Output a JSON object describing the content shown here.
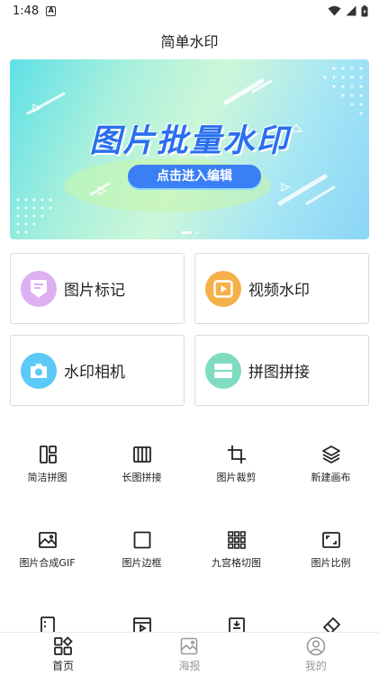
{
  "status_bar": {
    "time": "1:48",
    "notification_badge": "A"
  },
  "header": {
    "title": "简单水印"
  },
  "banner": {
    "headline": "图片批量水印",
    "cta": "点击进入编辑"
  },
  "cards": [
    {
      "label": "图片标记",
      "icon": "image-mark-icon",
      "color": "#d7a3ee"
    },
    {
      "label": "视频水印",
      "icon": "video-play-icon",
      "color": "#f5b04a"
    },
    {
      "label": "水印相机",
      "icon": "camera-icon",
      "color": "#5cc9f7"
    },
    {
      "label": "拼图拼接",
      "icon": "stitch-icon",
      "color": "#7fdcc0"
    }
  ],
  "tools": [
    {
      "label": "简洁拼图",
      "icon": "simple-collage-icon"
    },
    {
      "label": "长图拼接",
      "icon": "long-image-icon"
    },
    {
      "label": "图片裁剪",
      "icon": "crop-icon"
    },
    {
      "label": "新建画布",
      "icon": "layers-icon"
    },
    {
      "label": "图片合成GIF",
      "icon": "gif-image-icon"
    },
    {
      "label": "图片边框",
      "icon": "border-frame-icon"
    },
    {
      "label": "九宫格切图",
      "icon": "nine-grid-icon"
    },
    {
      "label": "图片比例",
      "icon": "ratio-icon"
    }
  ],
  "tools_partial": [
    {
      "icon": "film-strip-icon"
    },
    {
      "icon": "video-frame-icon"
    },
    {
      "icon": "compress-icon"
    },
    {
      "icon": "eraser-icon"
    }
  ],
  "bottom_nav": [
    {
      "label": "首页",
      "icon": "home-grid-icon",
      "active": true
    },
    {
      "label": "海报",
      "icon": "poster-icon",
      "active": false
    },
    {
      "label": "我的",
      "icon": "profile-icon",
      "active": false
    }
  ],
  "colors": {
    "accent": "#3a7ff5",
    "text": "#222222",
    "muted": "#999999",
    "card_border": "#dadada"
  }
}
